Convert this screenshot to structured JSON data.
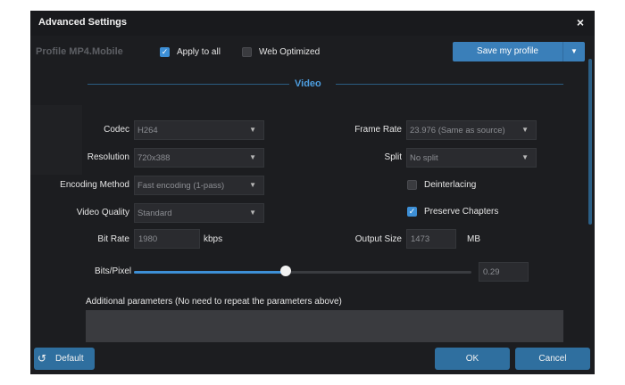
{
  "window": {
    "title": "Advanced Settings",
    "close_icon": "×"
  },
  "profile": {
    "name": "Profile MP4.Mobile",
    "apply_to_all": {
      "label": "Apply to all",
      "checked": true
    },
    "web_optimized": {
      "label": "Web Optimized",
      "checked": false
    },
    "save_label": "Save my profile"
  },
  "section": {
    "title": "Video"
  },
  "left": {
    "codec": {
      "label": "Codec",
      "value": "H264"
    },
    "resolution": {
      "label": "Resolution",
      "value": "720x388"
    },
    "encoding_method": {
      "label": "Encoding Method",
      "value": "Fast encoding (1-pass)"
    },
    "video_quality": {
      "label": "Video Quality",
      "value": "Standard"
    },
    "bit_rate": {
      "label": "Bit Rate",
      "value": "1980",
      "unit": "kbps"
    }
  },
  "right": {
    "frame_rate": {
      "label": "Frame Rate",
      "value": "23.976 (Same as source)"
    },
    "split": {
      "label": "Split",
      "value": "No split"
    },
    "deinterlacing": {
      "label": "Deinterlacing",
      "checked": false
    },
    "preserve_chapters": {
      "label": "Preserve Chapters",
      "checked": true
    },
    "output_size": {
      "label": "Output Size",
      "value": "1473",
      "unit": "MB"
    }
  },
  "bits_per_pixel": {
    "label": "Bits/Pixel",
    "value": "0.29",
    "level_fraction": 0.45
  },
  "additional": {
    "label": "Additional parameters (No need to repeat the parameters above)",
    "value": ""
  },
  "footer": {
    "default_label": "Default",
    "ok_label": "OK",
    "cancel_label": "Cancel"
  },
  "colors": {
    "accent": "#3d8fd6",
    "button": "#2f6f9f",
    "background": "#1c1d20"
  },
  "icons": {
    "dropdown": "caret-down-icon",
    "default": "reset-icon",
    "check": "check-icon"
  }
}
